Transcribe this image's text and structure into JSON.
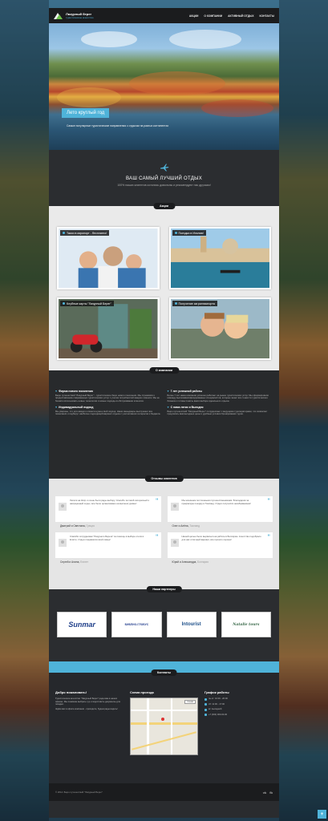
{
  "header": {
    "logo_title": "Лазурный берег",
    "logo_sub": "туристическое агентство",
    "nav": [
      "Акции",
      "О компании",
      "Активный отдых",
      "Контакты"
    ]
  },
  "hero": {
    "title": "Лето круглый год",
    "text": "Самые популярные туристические направления с отдыхом на разных континентах"
  },
  "slogan": {
    "icon": "plane-icon",
    "title": "Ваш самый лучший отдых",
    "subtitle": "100% наших клиентов остались довольны и рекомендуют нас друзьям!"
  },
  "sections": {
    "promos": "Акции",
    "about": "О компании",
    "reviews": "Отзывы клиентов",
    "partners": "Наши партнеры",
    "contacts": "Контакты"
  },
  "promos": [
    {
      "label": "Такси в аэропорт - бесплатно!"
    },
    {
      "label": "Поездка в Италию!"
    },
    {
      "label": "Клубные карты \"Лазурный Берег\""
    },
    {
      "label": "Получение загранпаспорта"
    }
  ],
  "about": [
    {
      "title": "Фирма нового поколения",
      "text": "Бюро путешествий \"Лазурный Берег\" - туристическое бюро нового поколения. Мы стремимся к предоставлению современных туристических услуг с учетом потребностей каждого клиента. Мы не боимся использовать новые технологии и новые подходы в обслуживании клиентов."
    },
    {
      "title": "7 лет успешной работы",
      "text": "Более 7 лет наша компания успешно работает на рынке туристических услуг. Мы сформировали команду высококвалифицированных специалистов, которые знают все тонкости туристического бизнеса и готовы помочь вам в выборе идеального отдыха."
    },
    {
      "title": "Индивидуальный подход",
      "text": "Мы уверены, что для каждого клиента нужен свой подход. Наши менеджеры выслушают все пожелания и подберут наиболее подходящий вариант отдыха с учетом ваших интересов и бюджета."
    },
    {
      "title": "С нами легко и Выгодно",
      "text": "Бюро путешествий \"Лазурный Берег\" сотрудничает с ведущими туроператорами, что позволяет предлагать вам выгодные цены и удобные условия бронирования туров."
    }
  ],
  "reviews": [
    {
      "text": "Летали на Кипр и очень были рады выбору. Спасибо за такой интересный и насыщенный отдых, все было организовано на высшем уровне!",
      "name": "Дмитрий и Светлана,",
      "city": "Греция"
    },
    {
      "text": "Мы начинаем постоянными путешественниками. Благодарим за прекрасную поездку в Таиланд. Отдых получился незабываемым!",
      "name": "Олег и Алёна,",
      "city": "Таиланд"
    },
    {
      "text": "Спасибо сотрудникам \"Лазурного Берега\" за помощь в выборе отеля в Египте. Отдых понравился всей семье!",
      "name": "Сергей и Алина,",
      "city": "Египет"
    },
    {
      "text": "Нашей целью было вырваться на работы в Болгарию. Агентство подобрало для нас отличный вариант, все прошло хорошо!",
      "name": "Юрий и Александра,",
      "city": "Болгария"
    }
  ],
  "partners": [
    {
      "name": "Sunmar",
      "color": "#1f3f8a",
      "accent": "#d0263a"
    },
    {
      "name": "БИБЛИО-ГЛОБУС",
      "color": "#26408f",
      "accent": "#26408f"
    },
    {
      "name": "Intourist",
      "color": "#1d4f8a",
      "accent": "#1d4f8a"
    },
    {
      "name": "Natalie tours",
      "color": "#3a6a4a",
      "accent": "#3a6a4a"
    }
  ],
  "contacts": {
    "welcome_title": "Добро пожаловать!",
    "welcome_text": [
      "Туристическое агентство \"Лазурный Берег\" рада вам в наших офисах. Мы поможем выбрать тур и подготовить документы для поездки.",
      "Ждём вас в офисе компании - приходите, будем рады видеть!"
    ],
    "map_title": "Схема проезда",
    "map_select": "Схема",
    "hours_title": "График работы",
    "hours": [
      "пн-пт: 10:00 - 20:00",
      "сб: 11:00 - 17:00",
      "вс: выходной",
      "+7 (000) 000-00-00"
    ]
  },
  "footer": {
    "copy": "© 2014. Бюро путешествий \"Лазурный Берег\"",
    "social": [
      "vk",
      "fb"
    ]
  },
  "colors": {
    "accent": "#4fb3d9",
    "dark": "#1b1c1e"
  }
}
